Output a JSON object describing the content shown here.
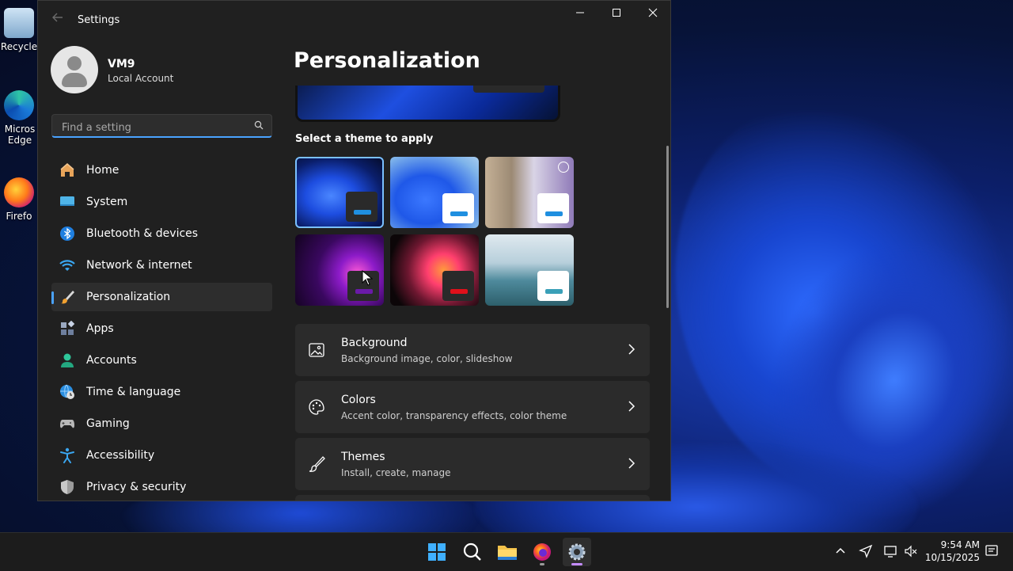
{
  "desktop": {
    "icons": [
      {
        "label": "Recycle"
      },
      {
        "label": "Micros Edge"
      },
      {
        "label": "Firefo"
      }
    ]
  },
  "window": {
    "title": "Settings",
    "controls": {
      "minimize": "—",
      "maximize": "☐",
      "close": "✕"
    }
  },
  "user": {
    "name": "VM9",
    "account_type": "Local Account"
  },
  "search": {
    "placeholder": "Find a setting"
  },
  "sidebar": {
    "items": [
      {
        "label": "Home",
        "icon": "home-icon"
      },
      {
        "label": "System",
        "icon": "system-icon"
      },
      {
        "label": "Bluetooth & devices",
        "icon": "bluetooth-icon"
      },
      {
        "label": "Network & internet",
        "icon": "wifi-icon"
      },
      {
        "label": "Personalization",
        "icon": "brush-icon",
        "active": true
      },
      {
        "label": "Apps",
        "icon": "apps-icon"
      },
      {
        "label": "Accounts",
        "icon": "accounts-icon"
      },
      {
        "label": "Time & language",
        "icon": "globe-clock-icon"
      },
      {
        "label": "Gaming",
        "icon": "gamepad-icon"
      },
      {
        "label": "Accessibility",
        "icon": "accessibility-icon"
      },
      {
        "label": "Privacy & security",
        "icon": "shield-icon"
      }
    ]
  },
  "main": {
    "title": "Personalization",
    "themes_label": "Select a theme to apply",
    "themes": [
      {
        "name": "theme-windows-dark",
        "accent": "#1f8fe0",
        "chip": "#2a2a2a",
        "selected": true
      },
      {
        "name": "theme-windows-light",
        "accent": "#1f8fe0",
        "chip": "#ffffff"
      },
      {
        "name": "theme-spotlight",
        "accent": "#1f8fe0",
        "chip": "#ffffff"
      },
      {
        "name": "theme-glow",
        "accent": "#6a1aa8",
        "chip": "#2a2a2a"
      },
      {
        "name": "theme-captured-motion",
        "accent": "#e0101a",
        "chip": "#2a2a2a"
      },
      {
        "name": "theme-flow",
        "accent": "#3aa0b8",
        "chip": "#ffffff"
      }
    ],
    "cards": [
      {
        "title": "Background",
        "subtitle": "Background image, color, slideshow",
        "icon": "image-icon"
      },
      {
        "title": "Colors",
        "subtitle": "Accent color, transparency effects, color theme",
        "icon": "palette-icon"
      },
      {
        "title": "Themes",
        "subtitle": "Install, create, manage",
        "icon": "brush-icon"
      }
    ]
  },
  "taskbar": {
    "apps": [
      "start-icon",
      "search-icon",
      "file-explorer-icon",
      "firefox-icon",
      "settings-icon"
    ],
    "clock": {
      "time": "9:54 AM",
      "date": "10/15/2025"
    }
  }
}
